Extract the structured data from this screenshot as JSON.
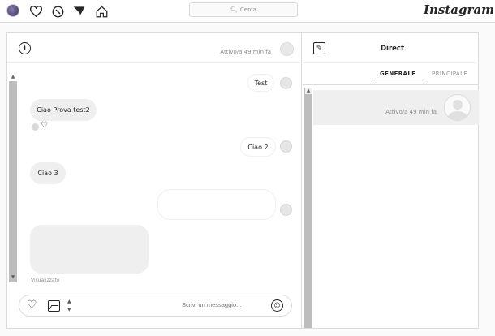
{
  "header": {
    "search_placeholder": "Cerca",
    "logo": "Instagram",
    "icons": [
      "profile-avatar",
      "home-icon",
      "direct-icon",
      "explore-icon",
      "heart-icon"
    ]
  },
  "conversation": {
    "status": "Attivo/a 49 min fa",
    "messages": [
      {
        "side": "out",
        "text": "Test"
      },
      {
        "side": "in",
        "text": "Ciao Prova test2"
      },
      {
        "side": "out",
        "text": "Ciao 2"
      },
      {
        "side": "in",
        "text": "Ciao 3"
      },
      {
        "side": "out",
        "text": ""
      },
      {
        "side": "in",
        "text": ""
      }
    ],
    "seen_label": "Visualizzato",
    "composer_placeholder": "Scrivi un messaggio..."
  },
  "inbox": {
    "title": "Direct",
    "tabs": [
      "GENERALE",
      "PRINCIPALE"
    ],
    "active_tab": "GENERALE",
    "threads": [
      {
        "status": "Attivo/a 49 min fa"
      }
    ]
  }
}
